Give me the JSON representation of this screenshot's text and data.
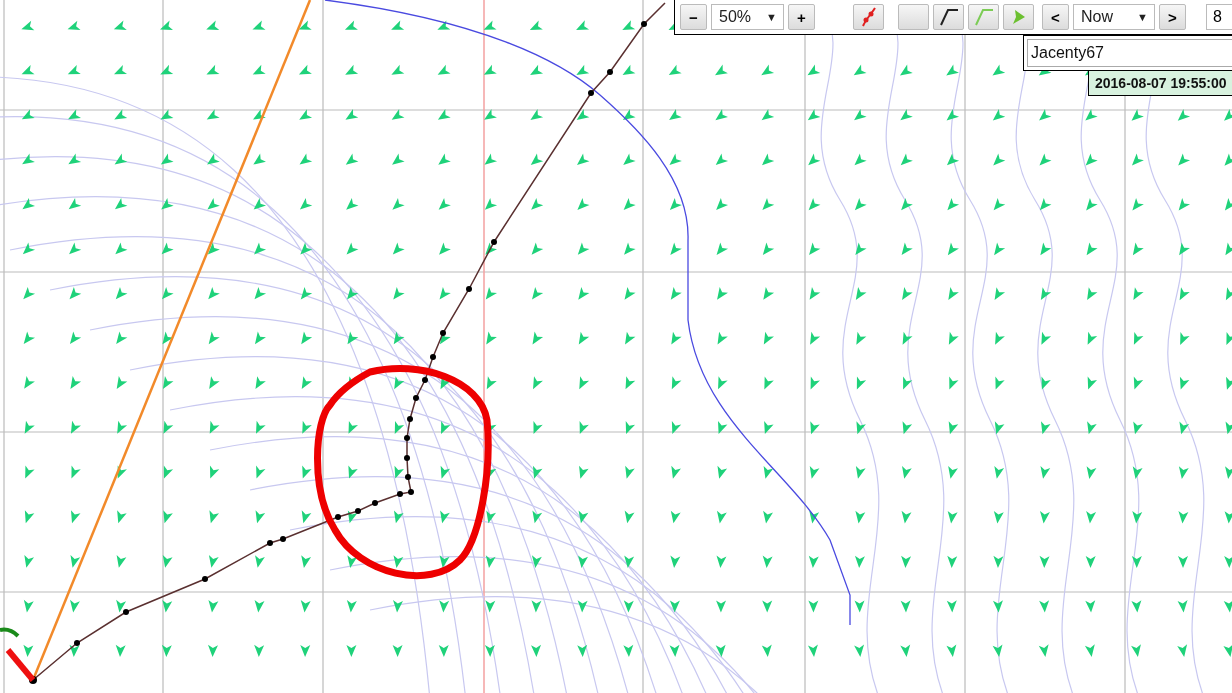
{
  "toolbar": {
    "zoom_out": "−",
    "zoom": "50%",
    "zoom_caret": "▼",
    "zoom_in": "+",
    "tools": [
      {
        "kind": "route"
      },
      {
        "kind": "blank"
      },
      {
        "kind": "track"
      },
      {
        "kind": "track-light"
      },
      {
        "kind": "boat"
      }
    ],
    "time_prev": "<",
    "time": "Now",
    "time_caret": "▼",
    "time_next": ">",
    "cut_field": "8"
  },
  "boat_name": "Jacenty67",
  "timestamp": "2016-08-07 19:55:00"
}
